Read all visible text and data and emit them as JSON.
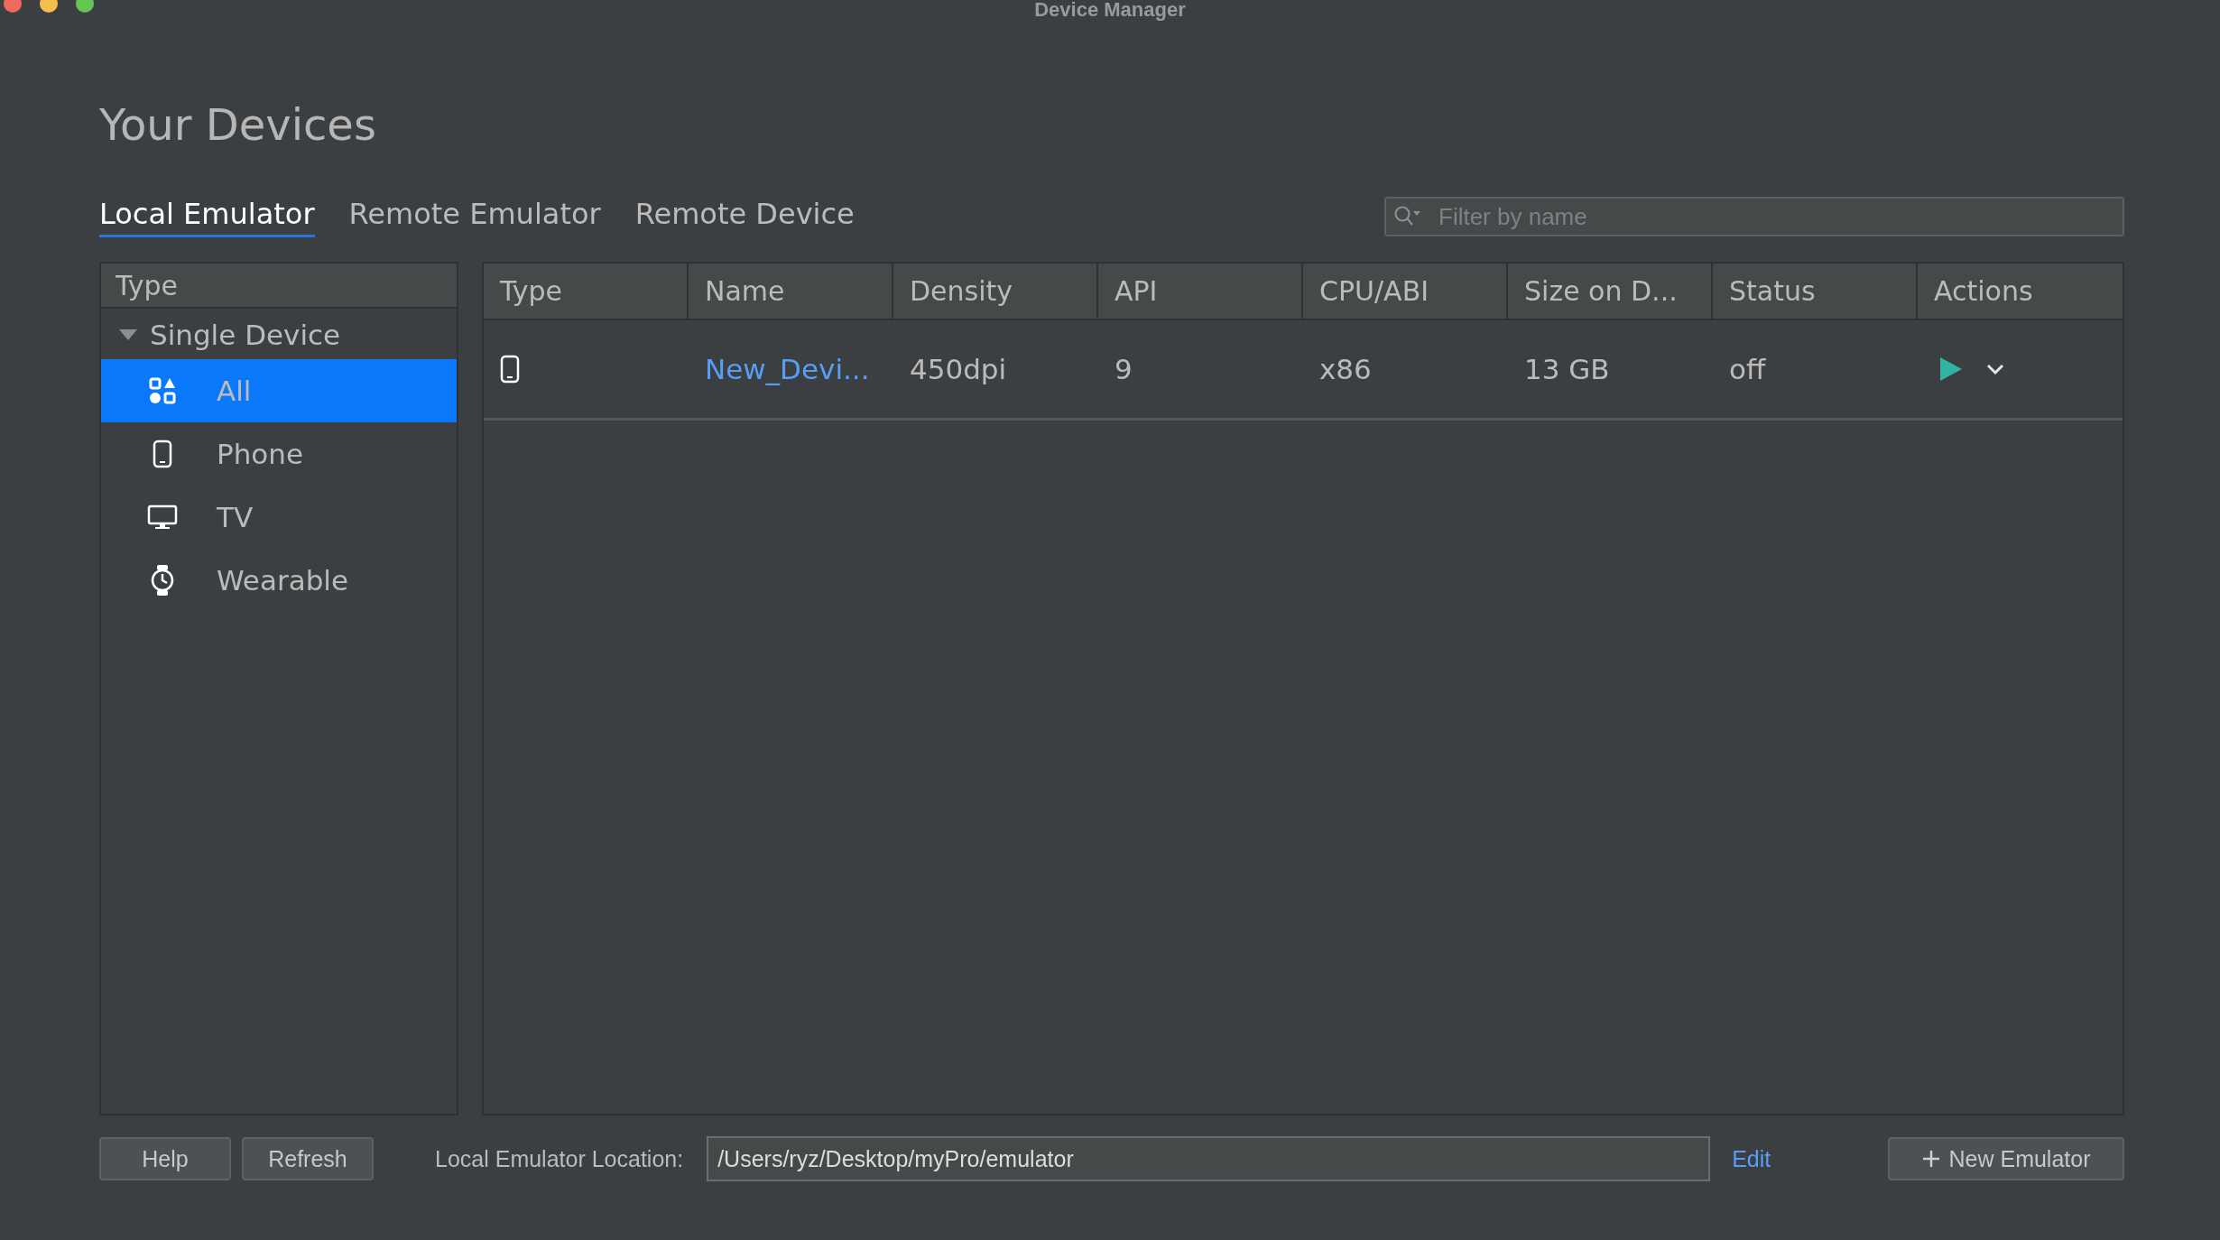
{
  "window": {
    "title": "Device Manager"
  },
  "heading": "Your Devices",
  "tabs": [
    {
      "label": "Local Emulator",
      "selected": true
    },
    {
      "label": "Remote Emulator",
      "selected": false
    },
    {
      "label": "Remote Device",
      "selected": false
    }
  ],
  "search": {
    "placeholder": "Filter by name"
  },
  "sidebar": {
    "header": "Type",
    "groups": [
      {
        "label": "Single Device",
        "expanded": true,
        "children": [
          {
            "label": "All",
            "kind": "all",
            "selected": true
          },
          {
            "label": "Phone",
            "kind": "phone",
            "selected": false
          },
          {
            "label": "TV",
            "kind": "tv",
            "selected": false
          },
          {
            "label": "Wearable",
            "kind": "watch",
            "selected": false
          }
        ]
      }
    ]
  },
  "table": {
    "columns": [
      "Type",
      "Name",
      "Density",
      "API",
      "CPU/ABI",
      "Size on D...",
      "Status",
      "Actions"
    ],
    "rows": [
      {
        "kind": "phone",
        "name": "New_Devi...",
        "density": "450dpi",
        "api": "9",
        "cpu_abi": "x86",
        "size": "13 GB",
        "status": "off"
      }
    ]
  },
  "footer": {
    "buttons": [
      "Help",
      "Refresh"
    ],
    "location_label": "Local Emulator Location:",
    "location_value": "/Users/ryz/Desktop/myPro/emulator",
    "edit_link": "Edit",
    "new_button": "New Emulator"
  }
}
